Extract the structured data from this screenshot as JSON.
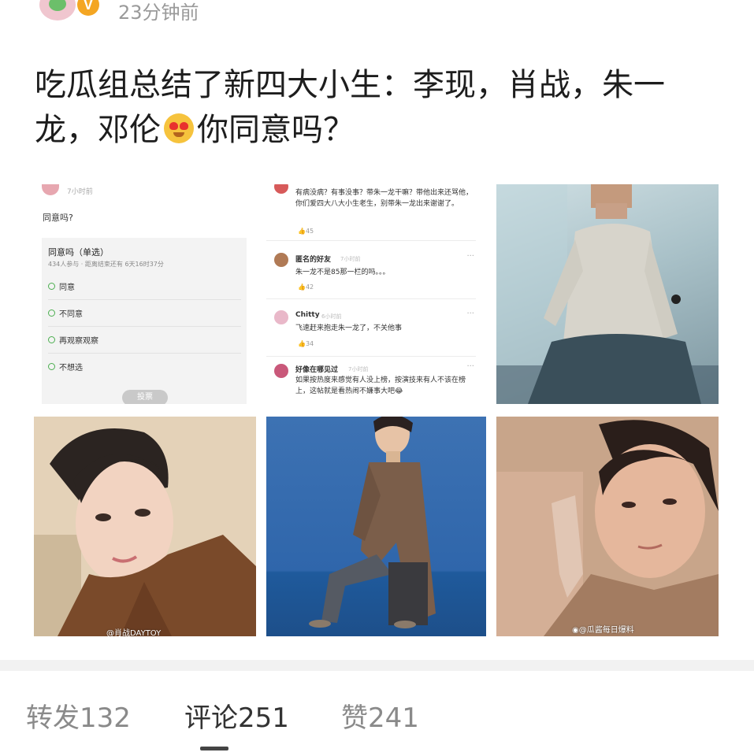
{
  "post": {
    "timestamp": "23分钟前",
    "verified_badge": "V",
    "title_part1": "吃瓜组总结了新四大小生：李现，肖战，朱一龙，邓伦",
    "title_part2": "你同意吗？",
    "title_emoji": "heart-eyes-emoji"
  },
  "poll_tile": {
    "time": "7小时前",
    "question": "同意吗?",
    "card_title": "同意吗（单选）",
    "card_sub": "434人参与 · 距离结束还有 6天16时37分",
    "options": [
      "同意",
      "不同意",
      "再观察观察",
      "不想选"
    ],
    "vote_label": "投票"
  },
  "comments_tile": {
    "comments": [
      {
        "name": "",
        "time": "",
        "text": "有病没病？有事没事？带朱一龙干嘛？带他出来还骂他，你们爱四大八大小生老生，别带朱一龙出来谢谢了。",
        "likes": "45"
      },
      {
        "name": "匿名的好友",
        "time": "7小时前",
        "text": "朱一龙不是85那一栏的吗。。。",
        "likes": "42"
      },
      {
        "name": "Chitty",
        "time": "6小时前",
        "text": "飞速赶来抱走朱一龙了，不关他事",
        "likes": "34"
      },
      {
        "name": "好像在哪见过",
        "time": "7小时前",
        "text": "如果按热度来感觉有人没上榜，按演技来有人不该在榜上，这帖就是看热闹不嫌事大吧😂",
        "likes": ""
      }
    ]
  },
  "watermarks": {
    "tile4": "@肖战DAYTOY",
    "tile6": "@瓜酱每日爆料"
  },
  "tabs": {
    "repost": "转发132",
    "comment": "评论251",
    "like": "赞241"
  },
  "colors": {
    "accent_indicator": "#444444",
    "tab_inactive": "#8a8a8a",
    "badge": "#f4a623"
  }
}
